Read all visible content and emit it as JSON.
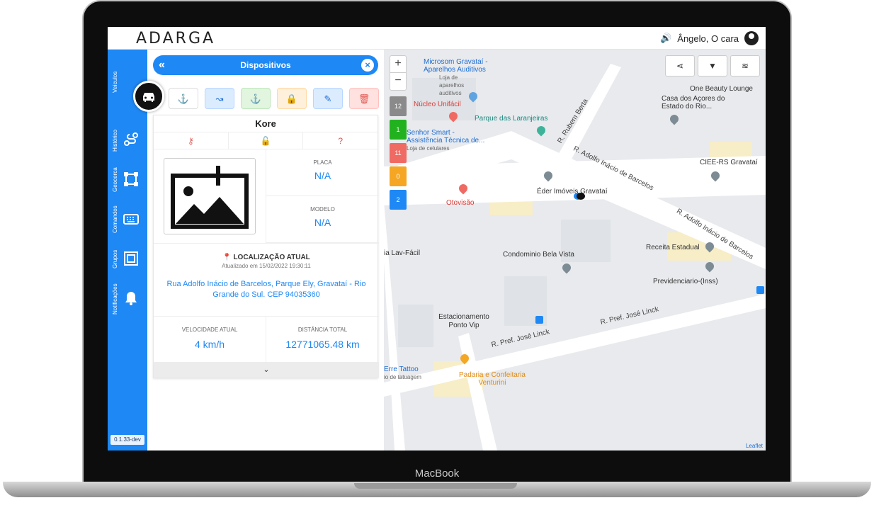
{
  "device_brand": "MacBook",
  "app": {
    "logo": "ADARGA",
    "user_name": "Ângelo, O cara",
    "sound_icon": "speaker-icon",
    "version": "0.1.33-dev"
  },
  "rail": {
    "items": [
      {
        "label": "Veículos",
        "icon": "car-icon"
      },
      {
        "label": "Histórico",
        "icon": "route-icon"
      },
      {
        "label": "Geocerca",
        "icon": "geofence-icon"
      },
      {
        "label": "Comandos",
        "icon": "keyboard-icon"
      },
      {
        "label": "Grupos",
        "icon": "groups-icon"
      },
      {
        "label": "Notificações",
        "icon": "bell-icon"
      }
    ]
  },
  "panel": {
    "title": "Dispositivos",
    "back_icon": "double-chevron-left-icon",
    "close_icon": "close-icon",
    "actions": [
      "anchor-icon",
      "route-icon",
      "anchor-icon",
      "lock-icon",
      "edit-icon",
      "trash-icon"
    ],
    "vehicle": {
      "name": "Kore",
      "status_icons": [
        "key-icon",
        "unlock-icon",
        "help-icon"
      ],
      "plate_label": "PLACA",
      "plate_value": "N/A",
      "model_label": "MODELO",
      "model_value": "N/A",
      "location_title": "LOCALIZAÇÃO ATUAL",
      "location_updated": "Atualizado em 15/02/2022 19:30:11",
      "location_address": "Rua Adolfo Inácio de Barcelos, Parque Ely, Gravataí - Rio Grande do Sul. CEP 94035360",
      "speed_label": "VELOCIDADE ATUAL",
      "speed_value": "4 km/h",
      "distance_label": "DISTÂNCIA TOTAL",
      "distance_value": "12771065.48 km"
    }
  },
  "map": {
    "zoom_in": "+",
    "zoom_out": "−",
    "counters": [
      {
        "value": "12",
        "color": "#8a8a8a"
      },
      {
        "value": "1",
        "color": "#22b21f"
      },
      {
        "value": "11",
        "color": "#ef6a63"
      },
      {
        "value": "0",
        "color": "#f5a623"
      },
      {
        "value": "2",
        "color": "#1e88f5"
      }
    ],
    "tools": [
      "share-icon",
      "filter-icon",
      "layers-icon"
    ],
    "places": {
      "microsom": "Microsom Gravataí - Aparelhos Auditivos",
      "microsom_sub": "Loja de aparelhos auditivos",
      "nucleo": "Núcleo Unifácil",
      "parque": "Parque das Laranjeiras",
      "senhor_smart": "Senhor Smart - Assistência Técnica de...",
      "senhor_smart_sub": "Loja de celulares",
      "one_beauty": "One Beauty Lounge",
      "casa_acores": "Casa dos Açores do Estado do Rio...",
      "ciee": "CIEE-RS Gravataí",
      "eder": "Éder Imóveis Gravataí",
      "otovisao": "Otovisão",
      "lav_facil": "ia Lav-Fácil",
      "condominio": "Condominio Bela Vista",
      "receita": "Receita Estadual",
      "previdenciario": "Previdenciario-(Inss)",
      "estacionamento": "Estacionamento Ponto Vip",
      "erre_tattoo": "Erre Tattoo",
      "erre_tattoo_sub": "io de tatuagem",
      "padaria": "Padaria e Confeitaria Venturini"
    },
    "roads": {
      "rubem_berta": "R. Rubem Berta",
      "adolfo_1": "R. Adolfo Inácio de Barcelos",
      "adolfo_2": "R. Adolfo Inácio de Barcelos",
      "linck_1": "R. Pref. José Linck",
      "linck_2": "R. Pref. José Linck"
    },
    "attribution": "Leaflet"
  }
}
